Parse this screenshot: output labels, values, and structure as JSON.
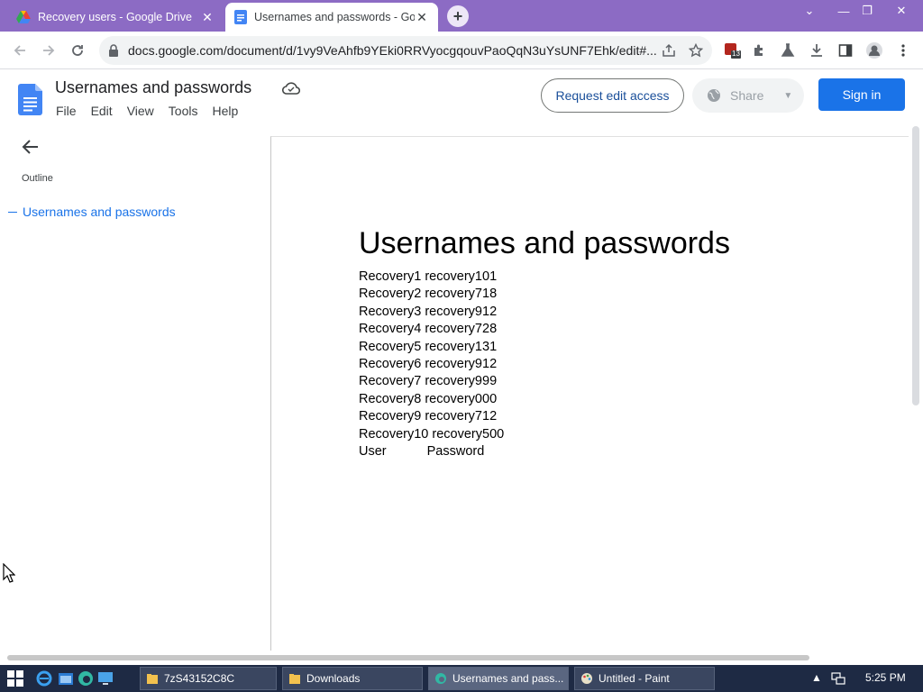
{
  "browser": {
    "tabs": [
      {
        "title": "Recovery users - Google Drive",
        "active": false
      },
      {
        "title": "Usernames and passwords - Go",
        "active": true
      }
    ],
    "url": "docs.google.com/document/d/1vy9VeAhfb9YEki0RRVyocgqouvPaoQqN3uYsUNF7Ehk/edit#...",
    "extension_badge": "13"
  },
  "docs": {
    "title": "Usernames and passwords",
    "menu": [
      "File",
      "Edit",
      "View",
      "Tools",
      "Help"
    ],
    "request_edit_label": "Request edit access",
    "share_label": "Share",
    "signin_label": "Sign in"
  },
  "outline": {
    "label": "Outline",
    "items": [
      "Usernames and passwords"
    ]
  },
  "document": {
    "heading": "Usernames and passwords",
    "lines": [
      "Recovery1 recovery101",
      "Recovery2 recovery718",
      "Recovery3 recovery912",
      "Recovery4 recovery728",
      "Recovery5 recovery131",
      "Recovery6 recovery912",
      "Recovery7 recovery999",
      "Recovery8 recovery000",
      "Recovery9 recovery712",
      "Recovery10 recovery500"
    ],
    "header_row": {
      "user": "User",
      "password": "Password"
    }
  },
  "taskbar": {
    "tasks": [
      {
        "label": "7zS43152C8C",
        "active": false
      },
      {
        "label": "Downloads",
        "active": false
      },
      {
        "label": "Usernames and pass...",
        "active": true
      },
      {
        "label": "Untitled - Paint",
        "active": false
      }
    ],
    "clock": "5:25 PM"
  },
  "colors": {
    "tabstrip": "#8c6bc4",
    "accent_blue": "#1a73e8",
    "taskbar": "#1e2a44"
  }
}
